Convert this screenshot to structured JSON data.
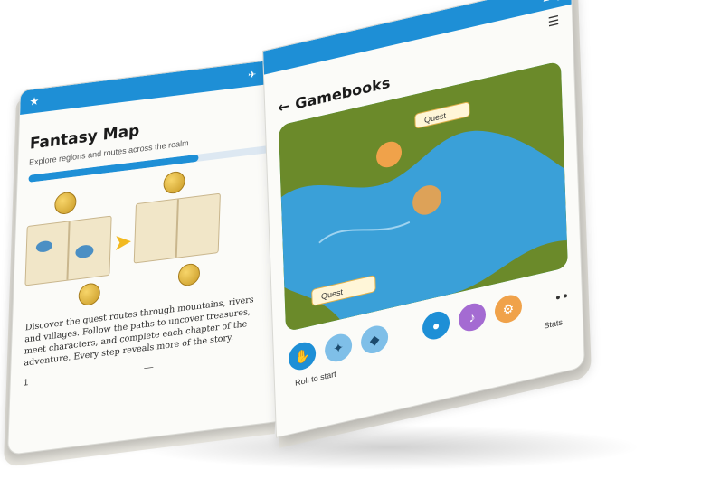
{
  "left_page": {
    "status_icons": [
      "airplane-icon",
      "wifi-icon",
      "battery-icon"
    ],
    "title": "Fantasy Map",
    "subtitle": "Explore regions and routes across the realm",
    "progress_fraction": 0.68,
    "paragraph": "Discover the quest routes through mountains, rivers and villages. Follow the paths to uncover treasures, meet characters, and complete each chapter of the adventure. Every step reveals more of the story.",
    "footer_left": "1",
    "footer_center": "—"
  },
  "right_page": {
    "app_title": "Gamebooks",
    "back_icon": "arrow-left-icon",
    "menu_icon": "hamburger-icon",
    "map_labels": [
      "Quest",
      "Quest"
    ],
    "controls_left": [
      "hand-icon",
      "fish-icon",
      "drop-icon"
    ],
    "controls_right": [
      "person-icon",
      "music-icon",
      "settings-icon"
    ],
    "caption_left": "Roll to start",
    "caption_right": "Stats",
    "colors": {
      "accent": "#1e8fd6",
      "water": "#3aa0d8",
      "land": "#6b8a2a",
      "marker": "#f0a24a"
    }
  }
}
